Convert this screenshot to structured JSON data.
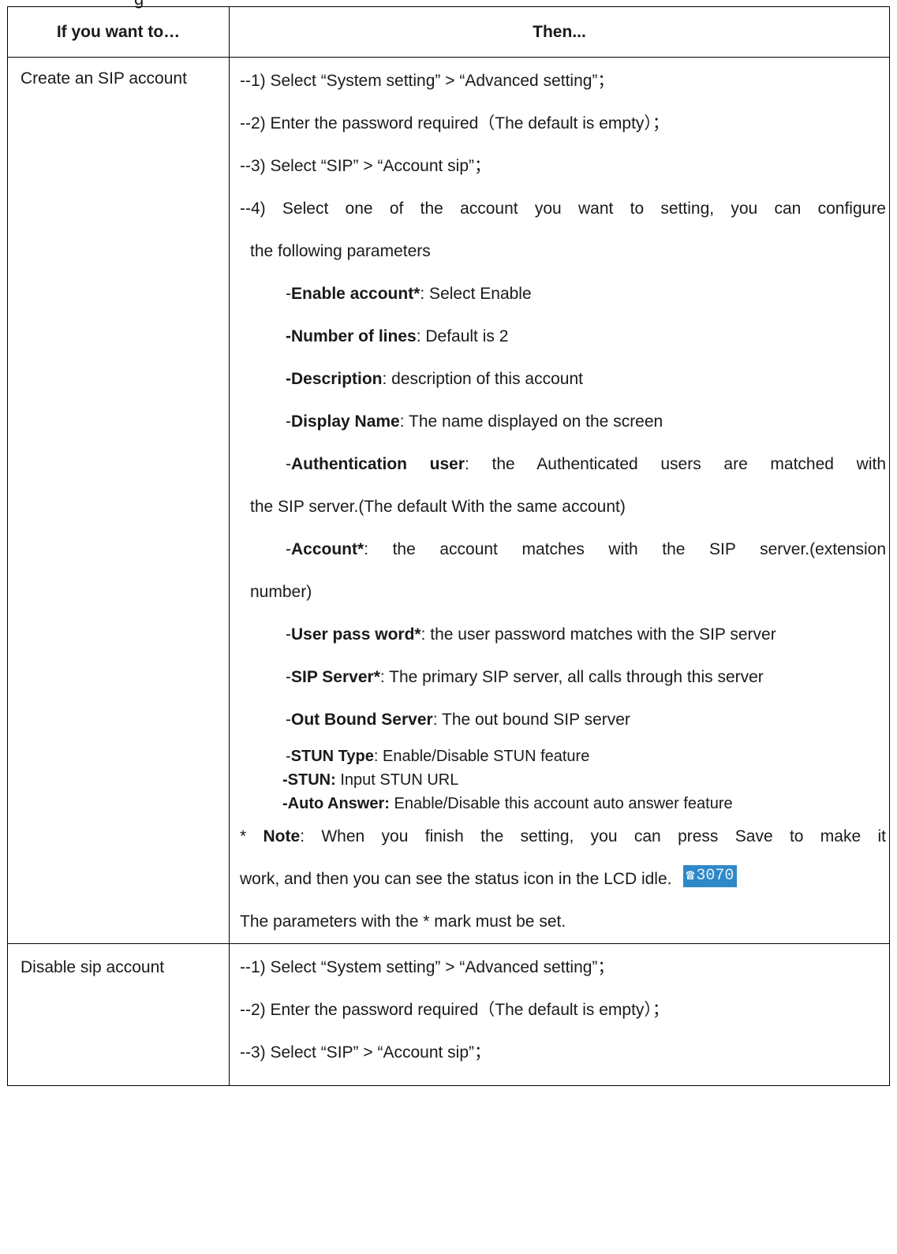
{
  "fragment_top": "g",
  "header": {
    "col1": "If you want to…",
    "col2": "Then..."
  },
  "rows": [
    {
      "action": "Create an SIP account",
      "step1": "--1) Select “System setting” > “Advanced setting”；",
      "step2": "--2) Enter the password required（The default is empty）；",
      "step3": "--3) Select “SIP” > “Account sip”；",
      "step4_a": "--4) Select one of the account you want to setting, you can configure",
      "step4_b": "the following parameters",
      "params": {
        "p1": {
          "prefix": "-",
          "label": "Enable account*",
          "text": ": Select Enable"
        },
        "p2": {
          "prefix": "",
          "label": "-Number of lines",
          "text": ": Default is 2"
        },
        "p3": {
          "prefix": "",
          "label": "-Description",
          "text": ": description of this account"
        },
        "p4": {
          "prefix": "-",
          "label": "Display Name",
          "text": ": The name displayed on the screen"
        },
        "p5": {
          "prefix": "-",
          "label": "Authentication user",
          "text": ": the Authenticated users are matched with",
          "cont": "the SIP server.(The default With the same account)"
        },
        "p6": {
          "prefix": "-",
          "label": "Account*",
          "text": ": the account matches with the SIP server.(extension",
          "cont": "number)"
        },
        "p7": {
          "prefix": "-",
          "label": "User pass word*",
          "text": ": the user password matches with the SIP server"
        },
        "p8": {
          "prefix": "-",
          "label": "SIP Server*",
          "text": ": The primary SIP server, all calls through this server"
        },
        "p9": {
          "prefix": "-",
          "label": "Out Bound Server",
          "text": ": The out bound SIP server"
        },
        "p10": {
          "prefix": "-",
          "label": "STUN Type",
          "text": ": Enable/Disable STUN feature"
        },
        "p11": {
          "prefix": "",
          "label": "-STUN:",
          "text": " Input STUN URL"
        },
        "p12": {
          "prefix": "",
          "label": "-Auto Answer:",
          "text": " Enable/Disable this account auto answer feature"
        }
      },
      "note_prefix": "* ",
      "note_label": "Note",
      "note_a": ": When you finish the setting, you can press Save to make it",
      "note_b": "work, and then you can see the status icon in the LCD idle.",
      "status_icon_text": "3070",
      "note_c": "The parameters with the * mark must be set."
    },
    {
      "action": "Disable sip account",
      "step1": "--1) Select “System setting” > “Advanced setting”；",
      "step2": "--2) Enter the password required（The default is empty）；",
      "step3": "--3) Select “SIP” > “Account sip”；"
    }
  ]
}
